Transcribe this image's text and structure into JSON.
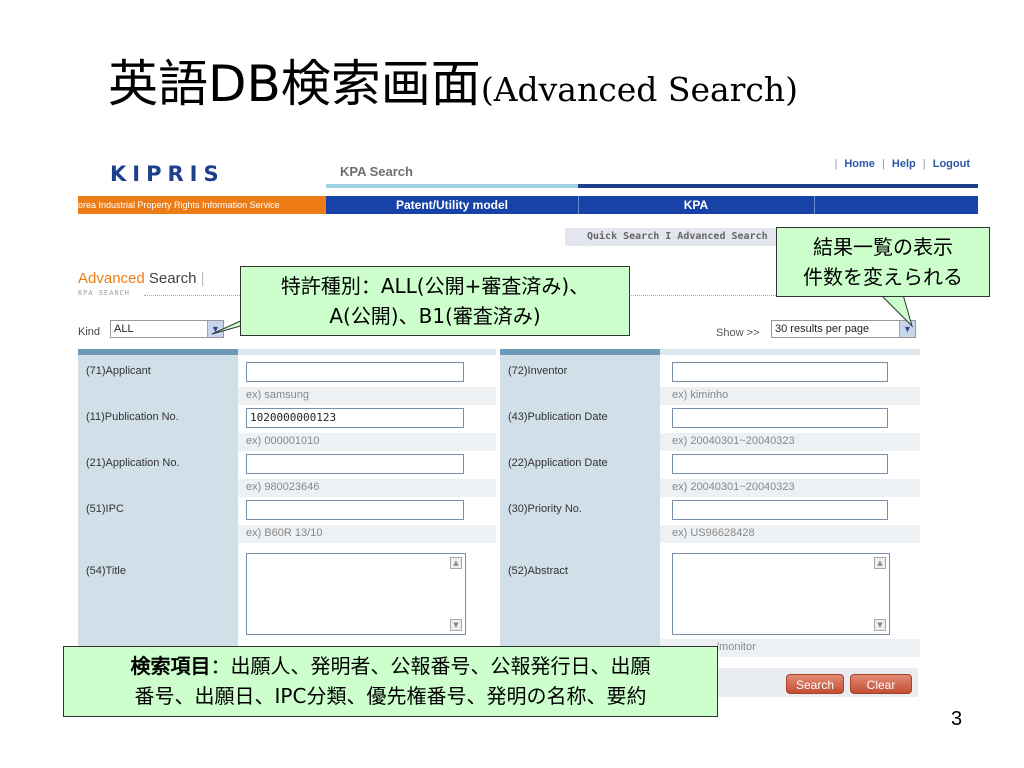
{
  "slide": {
    "title_jp": "英語DB検索画面",
    "title_en": "(Advanced Search)",
    "page_number": "3"
  },
  "header": {
    "logo": "KIPRIS",
    "section_title": "KPA Search",
    "links": [
      "Home",
      "Help",
      "Logout"
    ],
    "org_name": "orea Industrial Property Rights Information Service"
  },
  "nav": {
    "tabs": [
      "Patent/Utility model",
      "KPA"
    ],
    "subnav": "Quick Search I Advanced Search"
  },
  "page": {
    "heading_a": "Advanced",
    "heading_b": " Search",
    "sub": "KPA SEARCH",
    "kind_label": "Kind",
    "kind_value": "ALL",
    "show_label": "Show >>",
    "show_value": "30 results per page"
  },
  "form": {
    "left": [
      {
        "label": "(71)Applicant",
        "value": "",
        "example": "ex) samsung"
      },
      {
        "label": "(11)Publication No.",
        "value": "1020000000123",
        "example": "ex) 000001010"
      },
      {
        "label": "(21)Application No.",
        "value": "",
        "example": "ex) 980023646"
      },
      {
        "label": "(51)IPC",
        "value": "",
        "example": "ex) B60R 13/10"
      },
      {
        "label": "(54)Title",
        "value": "",
        "example": ""
      }
    ],
    "right": [
      {
        "label": "(72)Inventor",
        "value": "",
        "example": "ex) kiminho"
      },
      {
        "label": "(43)Publication Date",
        "value": "",
        "example": "ex) 20040301~20040323"
      },
      {
        "label": "(22)Application Date",
        "value": "",
        "example": "ex) 20040301~20040323"
      },
      {
        "label": "(30)Priority No.",
        "value": "",
        "example": "ex) US96628428"
      },
      {
        "label": "(52)Abstract",
        "value": "",
        "example": ""
      }
    ],
    "abstract_example_partial": "/monitor",
    "search_button": "Search",
    "clear_button": "Clear"
  },
  "callouts": {
    "kind": {
      "line1": "特許種別：ALL(公開+審査済み)、",
      "line2": "A(公開)、B1(審査済み)"
    },
    "results": {
      "line1": "結果一覧の表示",
      "line2": "件数を変えられる"
    },
    "fields": {
      "bold": "検索項目",
      "line1": "：出願人、発明者、公報番号、公報発行日、出願",
      "line2": "番号、出願日、IPC分類、優先権番号、発明の名称、要約"
    }
  },
  "colors": {
    "brand_blue": "#1743a8",
    "brand_orange": "#ee7c16",
    "callout_green": "#ccffcc",
    "button_red": "#c14e33"
  }
}
